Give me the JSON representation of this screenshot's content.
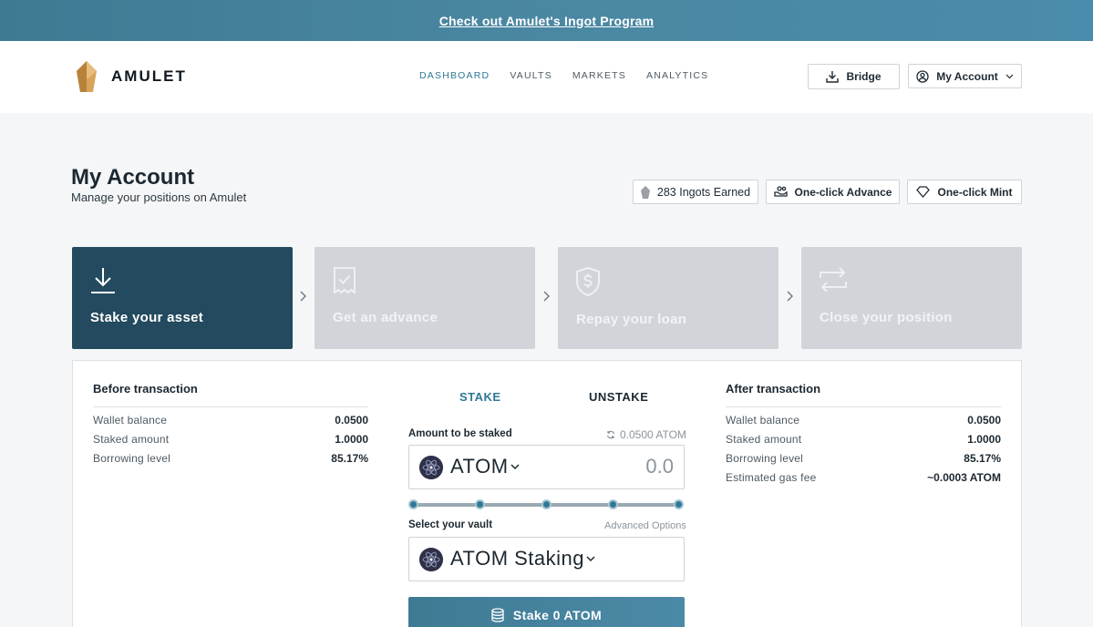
{
  "banner": {
    "text": "Check out Amulet's Ingot Program"
  },
  "brand": {
    "name": "AMULET",
    "accent": "#2f7896",
    "gold": "#c9913f"
  },
  "nav": {
    "items": [
      {
        "label": "DASHBOARD",
        "active": true
      },
      {
        "label": "VAULTS",
        "active": false
      },
      {
        "label": "MARKETS",
        "active": false
      },
      {
        "label": "ANALYTICS",
        "active": false
      }
    ],
    "bridge_label": "Bridge",
    "account_label": "My Account"
  },
  "page": {
    "title": "My Account",
    "subtitle": "Manage your positions on Amulet",
    "ingots_label": "283 Ingots Earned",
    "advance_label": "One-click Advance",
    "mint_label": "One-click Mint"
  },
  "steps": [
    {
      "label": "Stake your asset",
      "icon": "download-icon",
      "active": true
    },
    {
      "label": "Get an advance",
      "icon": "receipt-check-icon",
      "active": false
    },
    {
      "label": "Repay your loan",
      "icon": "dollar-shield-icon",
      "active": false
    },
    {
      "label": "Close your position",
      "icon": "swap-arrows-icon",
      "active": false
    }
  ],
  "before": {
    "title": "Before transaction",
    "rows": [
      {
        "label": "Wallet balance",
        "value": "0.0500"
      },
      {
        "label": "Staked amount",
        "value": "1.0000"
      },
      {
        "label": "Borrowing level",
        "value": "85.17%"
      }
    ]
  },
  "after": {
    "title": "After transaction",
    "rows": [
      {
        "label": "Wallet balance",
        "value": "0.0500"
      },
      {
        "label": "Staked amount",
        "value": "1.0000"
      },
      {
        "label": "Borrowing level",
        "value": "85.17%"
      },
      {
        "label": "Estimated gas fee",
        "value": "~0.0003 ATOM"
      }
    ]
  },
  "form": {
    "tabs": [
      {
        "label": "STAKE",
        "active": true
      },
      {
        "label": "UNSTAKE",
        "active": false
      }
    ],
    "amount_label": "Amount to be staked",
    "balance_hint": "0.0500 ATOM",
    "token": "ATOM",
    "amount_placeholder": "0.0",
    "slider_stops": 5,
    "slider_value": 0,
    "vault_label": "Select your vault",
    "advanced_label": "Advanced Options",
    "vault": "ATOM Staking",
    "submit_label": "Stake 0 ATOM"
  }
}
